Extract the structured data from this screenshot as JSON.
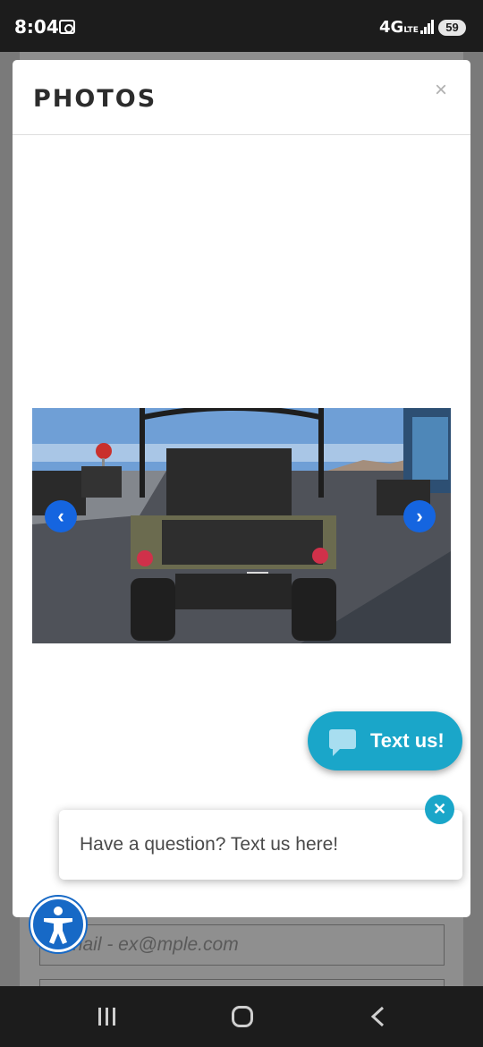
{
  "status_bar": {
    "time": "8:04",
    "network": "4G",
    "network_sub": "LTE",
    "battery": "59"
  },
  "background_form": {
    "email_placeholder": "Email - ex@mple.com"
  },
  "modal": {
    "title": "PHOTOS",
    "close_symbol": "×",
    "photo_icon": "image-utv-rear-view",
    "prev_symbol": "‹",
    "next_symbol": "›"
  },
  "chat_widget": {
    "button_label": "Text us!",
    "prompt": "Have a question? Text us here!",
    "close_symbol": "✕",
    "accent": "#1aa6c9"
  },
  "accessibility": {
    "icon": "accessibility-icon",
    "color": "#1769c6"
  },
  "colors": {
    "nav_button": "#1565e0"
  }
}
